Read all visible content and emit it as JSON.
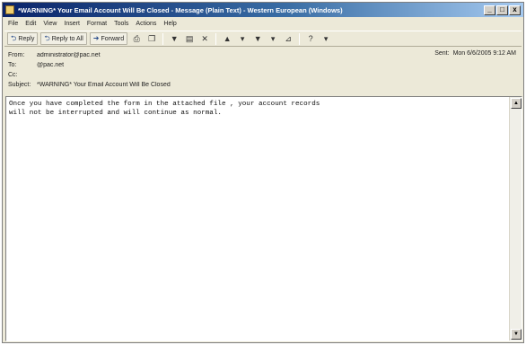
{
  "window": {
    "title": "*WARNING* Your Email Account Will Be Closed - Message (Plain Text) - Western European (Windows)",
    "controls": {
      "minimize": "_",
      "maximize": "□",
      "close": "x"
    }
  },
  "menu": [
    "File",
    "Edit",
    "View",
    "Insert",
    "Format",
    "Tools",
    "Actions",
    "Help"
  ],
  "toolbar": {
    "reply": "Reply",
    "reply_all": "Reply to All",
    "forward": "Forward",
    "print_icon": "print-icon",
    "flag_icon": "flag-icon",
    "delete_icon": "delete-icon",
    "help_icon": "help-icon"
  },
  "headers": {
    "from_label": "From:",
    "from_value": "administrator@pac.net",
    "to_label": "To:",
    "to_value": "@pac.net",
    "cc_label": "Cc:",
    "cc_value": "",
    "subject_label": "Subject:",
    "subject_value": "*WARNING* Your Email Account Will Be Closed",
    "sent_label": "Sent:",
    "sent_value": "Mon 6/6/2005 9:12 AM"
  },
  "message": {
    "body": "Once you have completed the form in the attached file , your account records\nwill not be interrupted and will continue as normal."
  }
}
